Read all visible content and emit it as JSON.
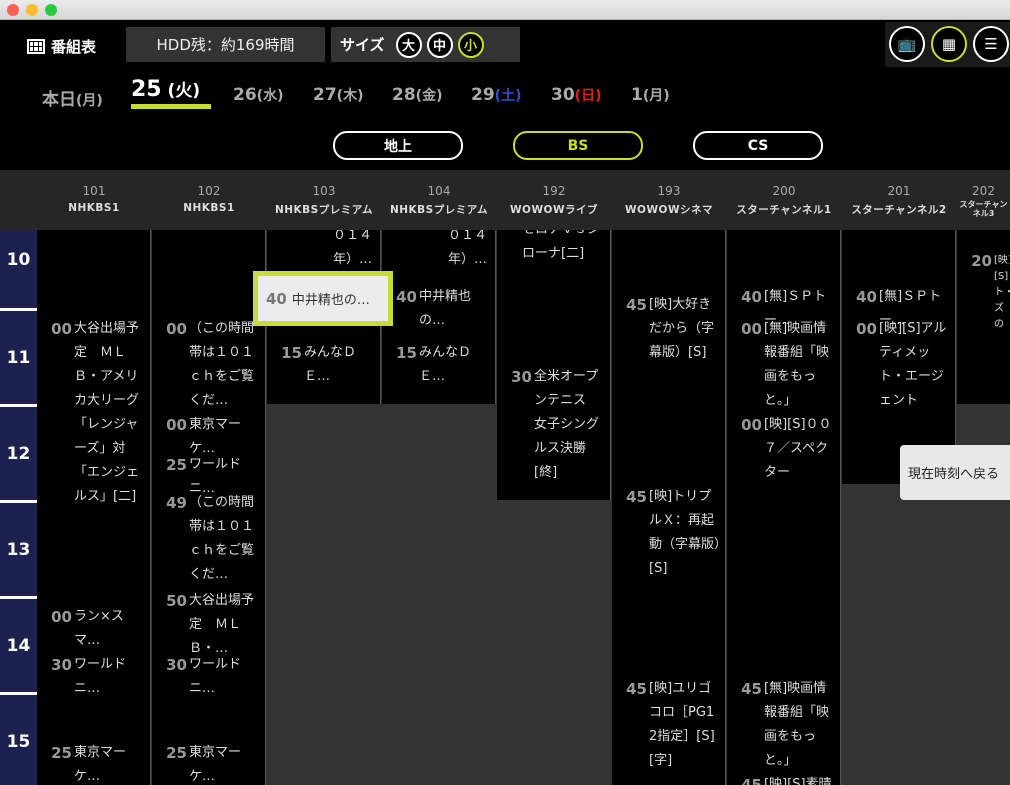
{
  "header": {
    "title": "番組表",
    "hdd": "HDD残：約169時間",
    "size_label": "サイズ",
    "sizes": [
      "大",
      "中",
      "小"
    ],
    "selected_size": "小",
    "accent": "#c8dc32"
  },
  "view_icons": [
    "tv-icon",
    "grid-icon",
    "list-icon"
  ],
  "dates": [
    {
      "day": "本日",
      "wd": "(月)"
    },
    {
      "day": "25",
      "wd": " (火)",
      "selected": true
    },
    {
      "day": "26",
      "wd": "(水)"
    },
    {
      "day": "27",
      "wd": "(木)"
    },
    {
      "day": "28",
      "wd": "(金)"
    },
    {
      "day": "29",
      "wd": "(土)",
      "color": "#3050d0"
    },
    {
      "day": "30",
      "wd": "(日)",
      "color": "#e02020"
    },
    {
      "day": "1",
      "wd": "(月)"
    }
  ],
  "tabs": [
    {
      "label": "地上"
    },
    {
      "label": "BS",
      "selected": true
    },
    {
      "label": "CS"
    }
  ],
  "hours": [
    "10",
    "11",
    "12",
    "13",
    "14",
    "15"
  ],
  "channels": [
    {
      "num": "101",
      "name": "NHKBS1",
      "until": "16:00",
      "programs": [
        {
          "start": "11:00",
          "min": "00",
          "title": "大谷出場予定　ＭＬＢ・アメリカ大リーグ「レンジャーズ」対「エンジェルス」[二]"
        },
        {
          "start": "14:00",
          "min": "00",
          "title": "ラン×スマ…"
        },
        {
          "start": "14:30",
          "min": "30",
          "title": "ワールドニ…"
        },
        {
          "start": "15:25",
          "min": "25",
          "title": "東京マーケ…"
        }
      ]
    },
    {
      "num": "102",
      "name": "NHKBS1",
      "until": "16:00",
      "programs": [
        {
          "start": "11:00",
          "min": "00",
          "title": "（この時間帯は１０１ｃｈをご覧くだ…"
        },
        {
          "start": "12:00",
          "min": "00",
          "title": "東京マーケ…"
        },
        {
          "start": "12:25",
          "min": "25",
          "title": "ワールドニ…"
        },
        {
          "start": "12:49",
          "min": "49",
          "title": "（この時間帯は１０１ｃｈをご覧くだ…"
        },
        {
          "start": "13:50",
          "min": "50",
          "title": "大谷出場予定　ＭＬＢ・…"
        },
        {
          "start": "14:30",
          "min": "30",
          "title": "ワールドニ…"
        },
        {
          "start": "15:25",
          "min": "25",
          "title": "東京マーケ…"
        }
      ]
    },
    {
      "num": "103",
      "name": "NHKBSプレミアム",
      "until": "12:00",
      "programs": [
        {
          "start": "10:00",
          "min": "",
          "title": "０１４年）…",
          "cont": true
        },
        {
          "start": "10:40",
          "min": "40",
          "title": "中井精也の…"
        },
        {
          "start": "11:15",
          "min": "15",
          "title": "みんなＤＥ…"
        }
      ]
    },
    {
      "num": "104",
      "name": "NHKBSプレミアム",
      "until": "12:00",
      "programs": [
        {
          "start": "10:00",
          "min": "",
          "title": "０１４年）…",
          "cont": true
        },
        {
          "start": "10:40",
          "min": "40",
          "title": "中井精也の…"
        },
        {
          "start": "11:15",
          "min": "15",
          "title": "みんなＤＥ…"
        }
      ]
    },
    {
      "num": "192",
      "name": "WOWOWライブ",
      "until": "13:00",
      "programs": [
        {
          "start": "09:58",
          "min": "",
          "title": "セロナｖｓジローナ[二]",
          "wrap": true
        },
        {
          "start": "11:30",
          "min": "30",
          "title": "全米オープンテニス　女子シングルス決勝[終]"
        }
      ]
    },
    {
      "num": "193",
      "name": "WOWOWシネマ",
      "until": "16:00",
      "programs": [
        {
          "start": "10:45",
          "min": "45",
          "title": "[映]大好きだから（字幕版）[S]"
        },
        {
          "start": "12:45",
          "min": "45",
          "title": "[映]トリプルＸ：再起動（字幕版）[S]"
        },
        {
          "start": "14:45",
          "min": "45",
          "title": "[映]ユリゴコロ［PG12指定］[S][字]"
        }
      ]
    },
    {
      "num": "200",
      "name": "スターチャンネル1",
      "until": "16:00",
      "programs": [
        {
          "start": "10:40",
          "min": "40",
          "title": "[無]ＳＰトー…"
        },
        {
          "start": "11:00",
          "min": "00",
          "title": "[無]映画情報番組「映画をもっと。」"
        },
        {
          "start": "12:00",
          "min": "00",
          "title": "[映][S]００７／スペクター"
        },
        {
          "start": "14:45",
          "min": "45",
          "title": "[無]映画情報番組「映画をもっと。」"
        },
        {
          "start": "15:45",
          "min": "45",
          "title": "[映][S]素晴らし"
        }
      ]
    },
    {
      "num": "201",
      "name": "スターチャンネル2",
      "until": "12:50",
      "programs": [
        {
          "start": "10:40",
          "min": "40",
          "title": "[無]ＳＰトー…"
        },
        {
          "start": "11:00",
          "min": "00",
          "title": "[映][S]アルティメット・エージェント"
        }
      ]
    },
    {
      "num": "202",
      "name": "スターチャンネル3",
      "until": "12:00",
      "programs": [
        {
          "start": "10:20",
          "min": "20",
          "title": "[映][S]ト・ズの"
        }
      ]
    }
  ],
  "selected_program": {
    "min": "40",
    "title": "中井精也の…"
  },
  "toast": "現在時刻へ戻る"
}
